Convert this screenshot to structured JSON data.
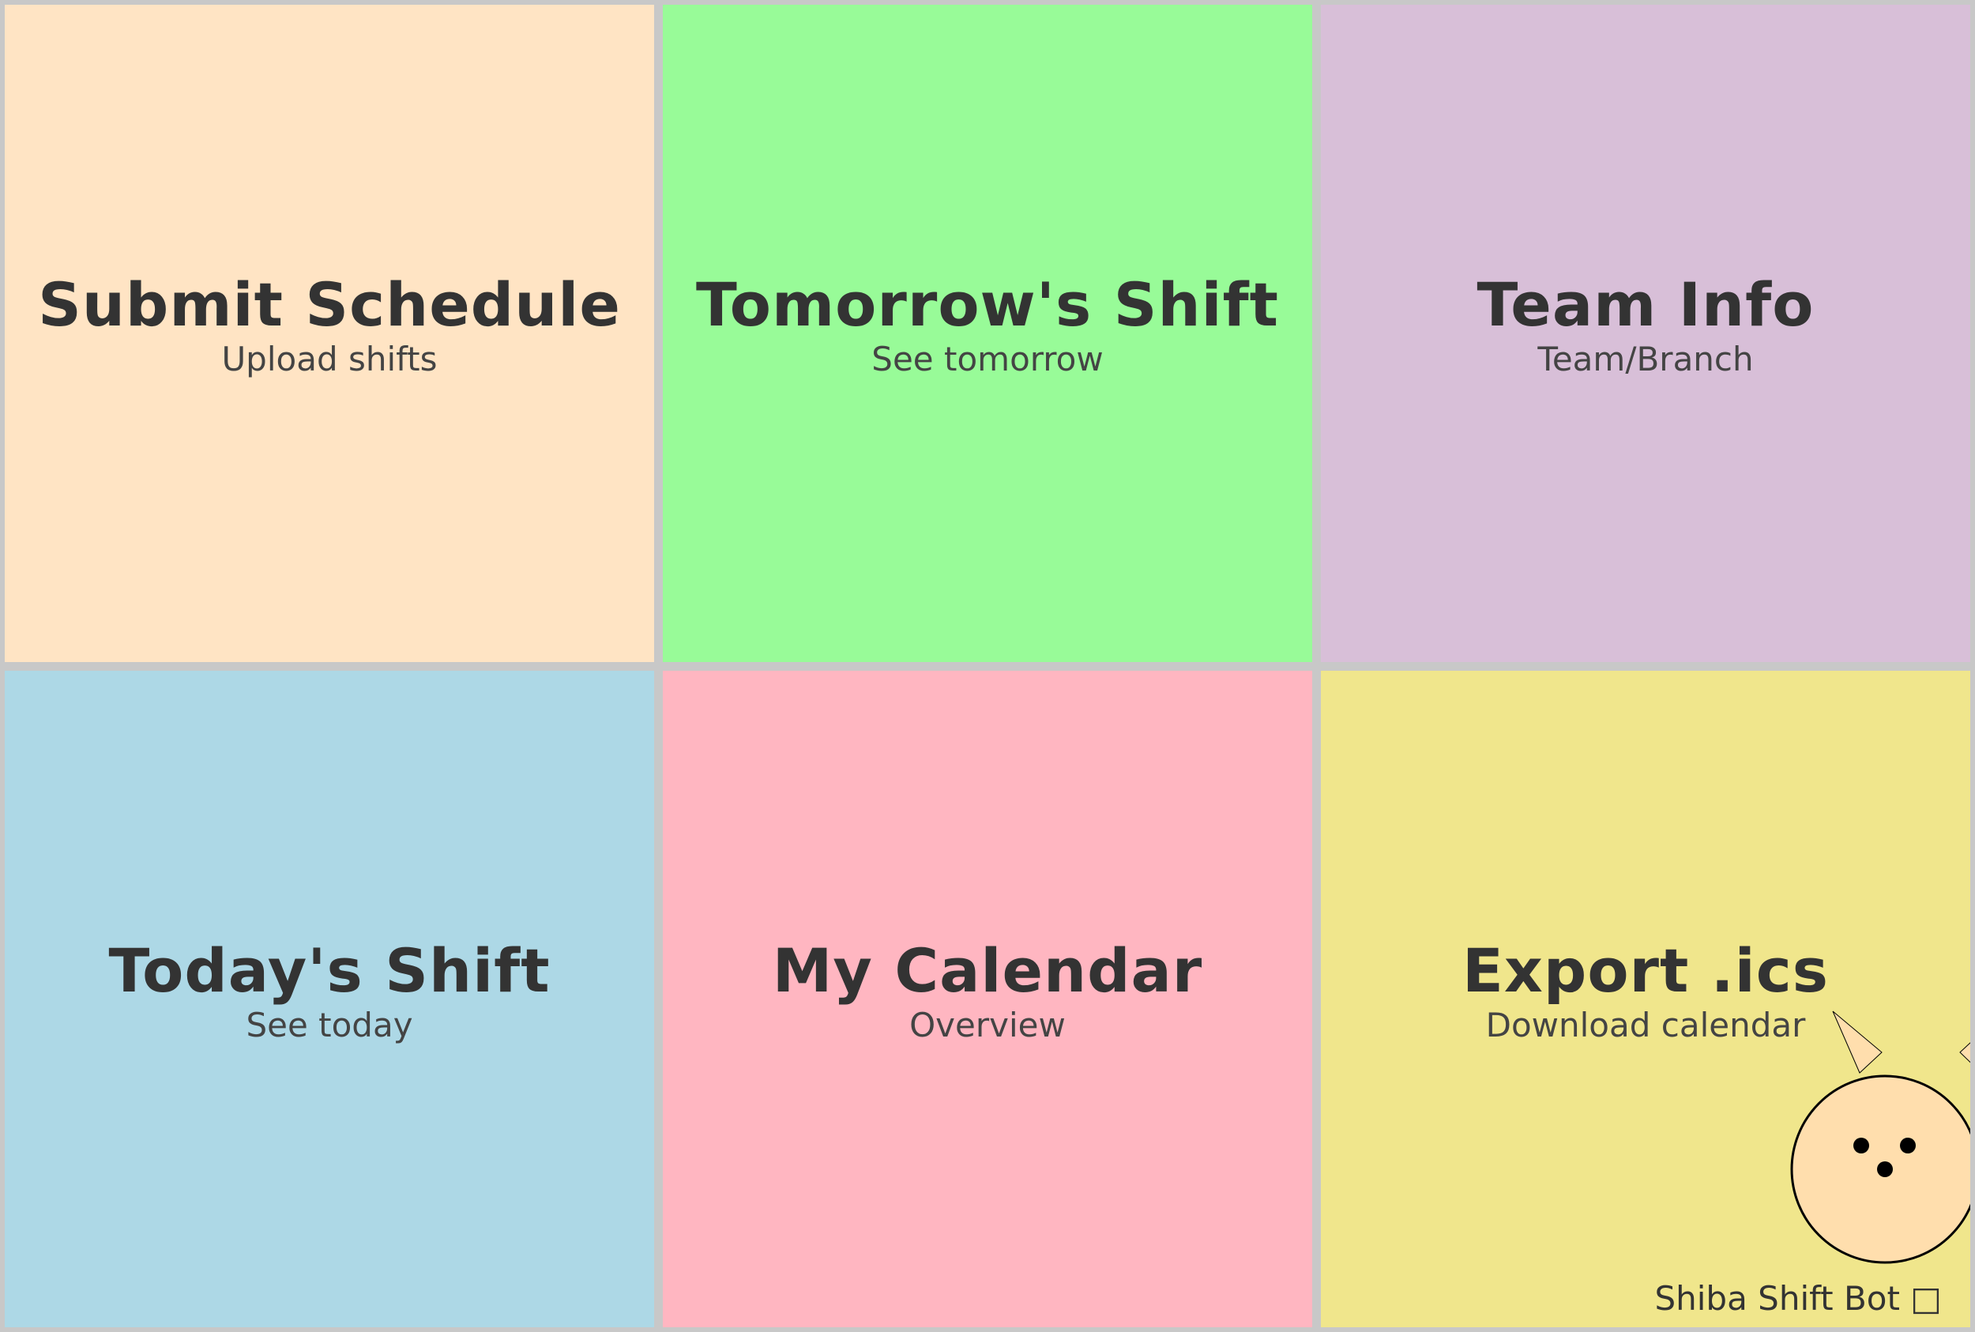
{
  "tiles": [
    {
      "title": "Submit Schedule",
      "subtitle": "Upload shifts",
      "color": "#FFE4C4"
    },
    {
      "title": "Tomorrow's Shift",
      "subtitle": "See tomorrow",
      "color": "#98FB98"
    },
    {
      "title": "Team Info",
      "subtitle": "Team/Branch",
      "color": "#D8BFD8"
    },
    {
      "title": "Today's Shift",
      "subtitle": "See today",
      "color": "#ADD8E6"
    },
    {
      "title": "My Calendar",
      "subtitle": "Overview",
      "color": "#FFB6C1"
    },
    {
      "title": "Export .ics",
      "subtitle": "Download calendar",
      "color": "#F0E68C"
    }
  ],
  "mascot": {
    "label": "Shiba Shift Bot □",
    "icon": "shiba-dog-icon",
    "face_color": "#FFDEAD",
    "outline_color": "#000000"
  },
  "colors": {
    "background": "#C8C8C8",
    "title_text": "#333333",
    "subtitle_text": "#444444"
  }
}
